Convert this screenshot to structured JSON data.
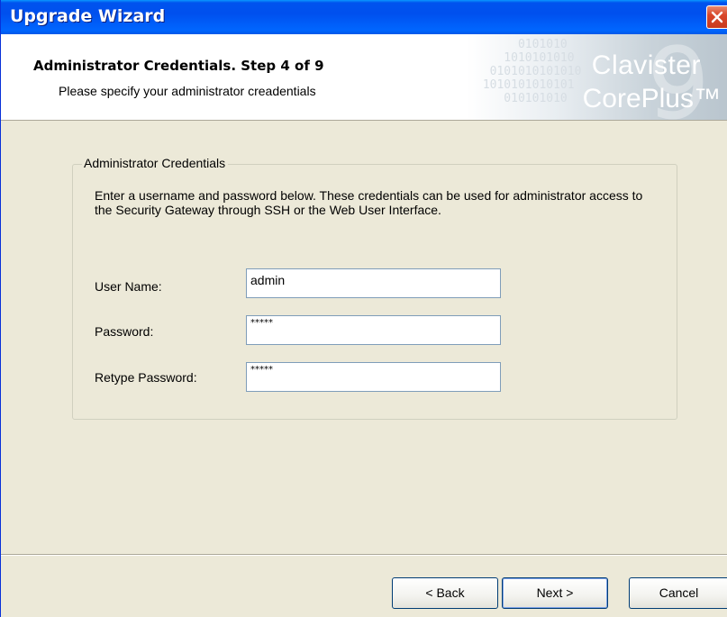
{
  "window": {
    "title": "Upgrade Wizard"
  },
  "header": {
    "step_title": "Administrator Credentials. Step 4 of 9",
    "step_subtitle": "Please specify your administrator creadentials",
    "logo_line1": "Clavister",
    "logo_line2": "CorePlus™",
    "logo_mark": "9"
  },
  "group": {
    "legend": "Administrator Credentials",
    "description": "Enter a username and password below. These credentials can be used for administrator access to the Security Gateway through SSH or the Web User Interface."
  },
  "fields": {
    "username": {
      "label": "User Name:",
      "value": "admin"
    },
    "password": {
      "label": "Password:",
      "value": "*****"
    },
    "retype": {
      "label": "Retype Password:",
      "value": "*****"
    }
  },
  "buttons": {
    "back": "< Back",
    "next": "Next >",
    "cancel": "Cancel"
  },
  "colors": {
    "titlebar": "#0055ea",
    "dialog_bg": "#ece9d8",
    "close_button": "#d9472b"
  }
}
